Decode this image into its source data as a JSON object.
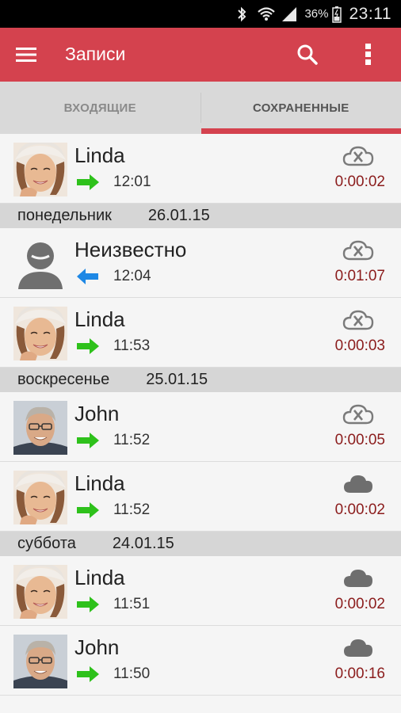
{
  "status_bar": {
    "battery_percent": "36%",
    "time": "23:11",
    "icons": [
      "bluetooth-icon",
      "wifi-icon",
      "signal-icon",
      "battery-icon"
    ]
  },
  "app_bar": {
    "title": "Записи",
    "icons": [
      "menu-icon",
      "search-icon",
      "more-vert-icon"
    ]
  },
  "tabs": [
    {
      "label": "ВХОДЯЩИЕ",
      "active": false
    },
    {
      "label": "СОХРАНЕННЫЕ",
      "active": true
    }
  ],
  "colors": {
    "accent": "#d4424e",
    "incoming_arrow": "#2ec11b",
    "outgoing_arrow": "#1e88e5",
    "duration": "#8b1c1c"
  },
  "sections": [
    {
      "weekday": "",
      "date": "",
      "items": [
        {
          "name": "Linda",
          "avatar": "female-photo",
          "direction": "incoming",
          "time": "12:01",
          "cloud": "cloud-crossed",
          "duration": "0:00:02"
        }
      ]
    },
    {
      "weekday": "понедельник",
      "date": "26.01.15",
      "items": [
        {
          "name": "Неизвестно",
          "avatar": "unknown-person",
          "direction": "outgoing",
          "time": "12:04",
          "cloud": "cloud-crossed",
          "duration": "0:01:07"
        },
        {
          "name": "Linda",
          "avatar": "female-photo",
          "direction": "incoming",
          "time": "11:53",
          "cloud": "cloud-crossed",
          "duration": "0:00:03"
        }
      ]
    },
    {
      "weekday": "воскресенье",
      "date": "25.01.15",
      "items": [
        {
          "name": "John",
          "avatar": "male-photo",
          "direction": "incoming",
          "time": "11:52",
          "cloud": "cloud-crossed",
          "duration": "0:00:05"
        },
        {
          "name": "Linda",
          "avatar": "female-photo",
          "direction": "incoming",
          "time": "11:52",
          "cloud": "cloud-filled",
          "duration": "0:00:02"
        }
      ]
    },
    {
      "weekday": "суббота",
      "date": "24.01.15",
      "items": [
        {
          "name": "Linda",
          "avatar": "female-photo",
          "direction": "incoming",
          "time": "11:51",
          "cloud": "cloud-filled",
          "duration": "0:00:02"
        },
        {
          "name": "John",
          "avatar": "male-photo",
          "direction": "incoming",
          "time": "11:50",
          "cloud": "cloud-filled",
          "duration": "0:00:16"
        }
      ]
    }
  ]
}
